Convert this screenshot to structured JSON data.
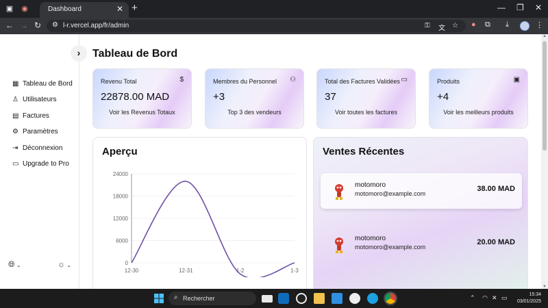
{
  "browser": {
    "tab_title": "Dashboard",
    "url": "l-r.vercel.app/fr/admin"
  },
  "sidebar": {
    "items": [
      {
        "label": "Tableau de Bord",
        "icon": "dashboard-grid-icon"
      },
      {
        "label": "Utilisateurs",
        "icon": "users-icon"
      },
      {
        "label": "Factures",
        "icon": "invoice-icon"
      },
      {
        "label": "Paramètres",
        "icon": "settings-icon"
      },
      {
        "label": "Déconnexion",
        "icon": "logout-icon"
      },
      {
        "label": "Upgrade to Pro",
        "icon": "card-icon"
      }
    ]
  },
  "page": {
    "title": "Tableau de Bord"
  },
  "cards": [
    {
      "title": "Revenu Total",
      "value": "22878.00 MAD",
      "link": "Voir les Revenus Totaux",
      "icon": "dollar-icon"
    },
    {
      "title": "Membres du Personnel",
      "value": "+3",
      "link": "Top 3 des vendeurs",
      "icon": "users-icon"
    },
    {
      "title": "Total des Factures Validées",
      "value": "37",
      "link": "Voir toutes les factures",
      "icon": "credit-card-icon"
    },
    {
      "title": "Produits",
      "value": "+4",
      "link": "Voir les meilleurs produits",
      "icon": "package-icon"
    }
  ],
  "overview": {
    "title": "Aperçu"
  },
  "chart_data": {
    "type": "line",
    "x": [
      "12-30",
      "12-31",
      "1-2",
      "1-3"
    ],
    "y_ticks": [
      "0",
      "6000",
      "12000",
      "18000",
      "24000"
    ],
    "ylim": [
      0,
      24000
    ],
    "series": [
      {
        "color": "#6d4fa3",
        "points": [
          [
            0,
            0
          ],
          [
            1,
            22000
          ],
          [
            2,
            -3000
          ],
          [
            3,
            0
          ]
        ]
      }
    ],
    "grid": true
  },
  "recent_sales": {
    "title": "Ventes Récentes",
    "items": [
      {
        "name": "motomoro",
        "email": "motomoro@example.com",
        "amount": "38.00 MAD"
      },
      {
        "name": "motomoro",
        "email": "motomoro@example.com",
        "amount": "20.00 MAD"
      }
    ]
  },
  "taskbar": {
    "search_label": "Rechercher",
    "time": "15:34",
    "date": "03/01/2025"
  }
}
